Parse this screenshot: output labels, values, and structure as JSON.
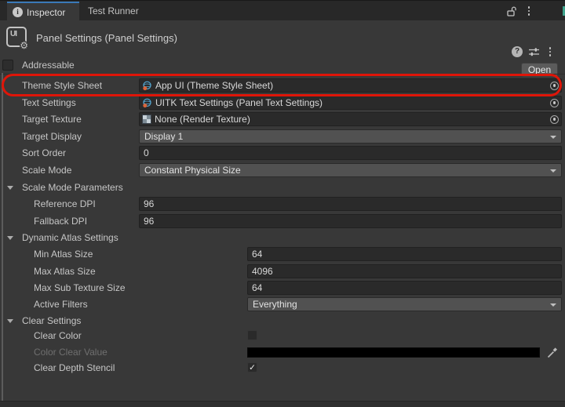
{
  "window": {
    "tabs": [
      {
        "label": "Inspector",
        "active": true
      },
      {
        "label": "Test Runner",
        "active": false
      }
    ],
    "title": "Panel Settings (Panel Settings)",
    "open_button": "Open",
    "asset_icon_text": "UI"
  },
  "addressable": {
    "label": "Addressable",
    "checked": false
  },
  "fields": {
    "theme_style_sheet": {
      "label": "Theme Style Sheet",
      "value": "App UI (Theme Style Sheet)"
    },
    "text_settings": {
      "label": "Text Settings",
      "value": "UITK Text Settings (Panel Text Settings)"
    },
    "target_texture": {
      "label": "Target Texture",
      "value": "None (Render Texture)"
    },
    "target_display": {
      "label": "Target Display",
      "value": "Display 1"
    },
    "sort_order": {
      "label": "Sort Order",
      "value": "0"
    },
    "scale_mode": {
      "label": "Scale Mode",
      "value": "Constant Physical Size"
    },
    "scale_mode_parameters": {
      "label": "Scale Mode Parameters",
      "expanded": true
    },
    "reference_dpi": {
      "label": "Reference DPI",
      "value": "96"
    },
    "fallback_dpi": {
      "label": "Fallback DPI",
      "value": "96"
    },
    "dynamic_atlas_settings": {
      "label": "Dynamic Atlas Settings",
      "expanded": true
    },
    "min_atlas_size": {
      "label": "Min Atlas Size",
      "value": "64"
    },
    "max_atlas_size": {
      "label": "Max Atlas Size",
      "value": "4096"
    },
    "max_sub_texture_size": {
      "label": "Max Sub Texture Size",
      "value": "64"
    },
    "active_filters": {
      "label": "Active Filters",
      "value": "Everything"
    },
    "clear_settings": {
      "label": "Clear Settings",
      "expanded": true
    },
    "clear_color": {
      "label": "Clear Color",
      "checked": false
    },
    "color_clear_value": {
      "label": "Color Clear Value",
      "color": "#000000",
      "disabled": true
    },
    "clear_depth_stencil": {
      "label": "Clear Depth Stencil",
      "checked": true,
      "check_glyph": "✓"
    }
  },
  "annotation": {
    "shape": "red-oval",
    "color": "#df1508",
    "highlights": "Theme Style Sheet row"
  },
  "icons": {
    "info-icon": "i in circle",
    "lock-icon": "open padlock",
    "kebab-icon": "vertical three dots",
    "help-icon": "? in circle",
    "preset-icon": "two sliders",
    "panel-settings-asset-icon": "UI square with gear",
    "theme-stylesheet-icon": "blue wire sphere with orange mark",
    "render-texture-icon": "checkerboard square",
    "object-picker-icon": "circled dot",
    "dropdown-arrow-icon": "down triangle",
    "foldout-icon": "down triangle",
    "eyedropper-icon": "color picker dropper"
  },
  "colors": {
    "background": "#383838",
    "tabbar": "#282828",
    "accent_tab_line": "#3a79b8",
    "field_bg": "#2a2a2a",
    "dropdown_bg": "#515151",
    "annotation_red": "#df1508"
  }
}
